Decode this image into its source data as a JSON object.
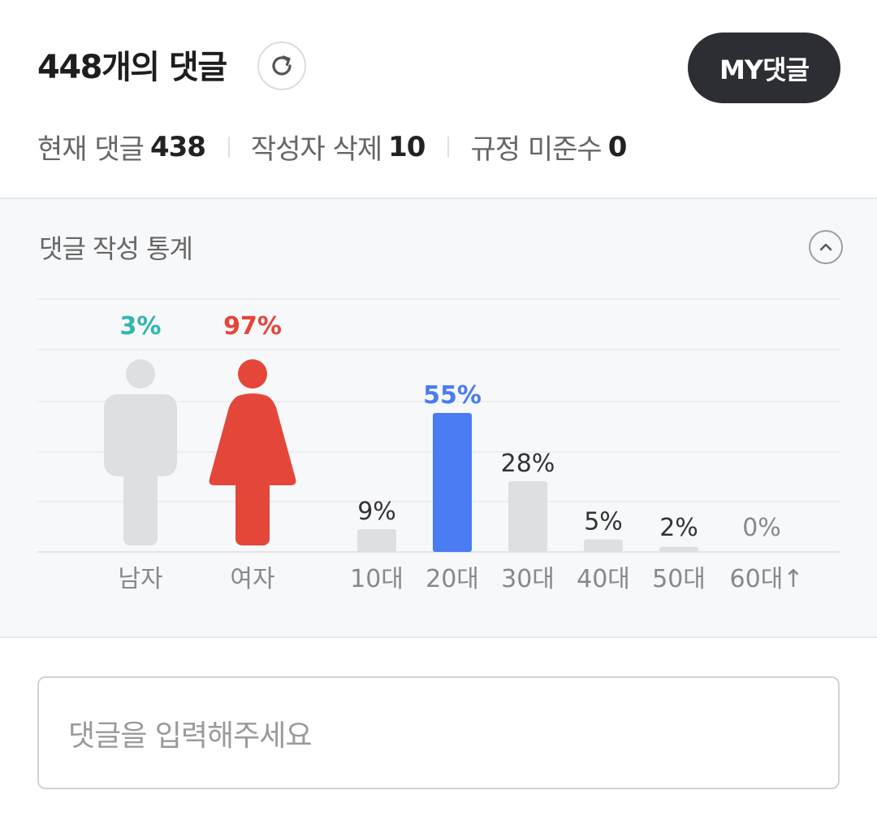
{
  "header": {
    "count": "448",
    "title_suffix": "개의 댓글",
    "my_button": "MY댓글"
  },
  "stats": [
    {
      "label": "현재 댓글",
      "value": "438"
    },
    {
      "label": "작성자 삭제",
      "value": "10"
    },
    {
      "label": "규정 미준수",
      "value": "0"
    }
  ],
  "statistics": {
    "title": "댓글 작성 통계"
  },
  "chart_data": {
    "type": "bar",
    "gender": {
      "categories": [
        "남자",
        "여자"
      ],
      "values": [
        3,
        97
      ],
      "value_labels": [
        "3%",
        "97%"
      ],
      "colors": [
        "#2fb7b3",
        "#e5463a"
      ]
    },
    "age": {
      "categories": [
        "10대",
        "20대",
        "30대",
        "40대",
        "50대",
        "60대↑"
      ],
      "values": [
        9,
        55,
        28,
        5,
        2,
        0
      ],
      "value_labels": [
        "9%",
        "55%",
        "28%",
        "5%",
        "2%",
        "0%"
      ],
      "highlight_index": 1,
      "highlight_color": "#4a7cf3",
      "bar_color": "#dde0e3"
    }
  },
  "comment_input": {
    "placeholder": "댓글을 입력해주세요"
  },
  "icons": {
    "refresh": "refresh-icon",
    "collapse": "chevron-up-icon"
  }
}
